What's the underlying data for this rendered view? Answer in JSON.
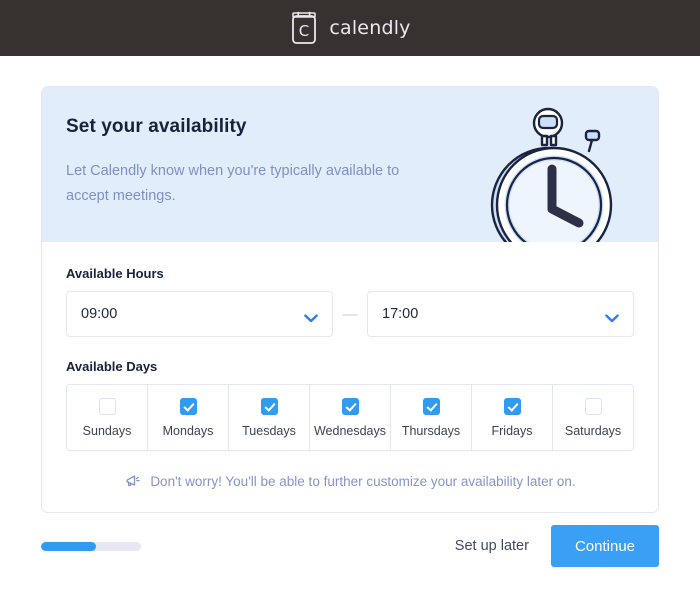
{
  "topbar": {
    "logo_icon": "calendly-calendar-icon",
    "logo_letter": "C",
    "wordmark": "calendly",
    "background": "#37312F"
  },
  "card": {
    "hero": {
      "title": "Set your availability",
      "subtitle": "Let Calendly know when you're typically available to accept meetings.",
      "illustration": "stopwatch-illustration",
      "background": "#E2EDFB"
    },
    "hours": {
      "label": "Available Hours",
      "start_value": "09:00",
      "end_value": "17:00",
      "separator": "—",
      "chevron_icon": "chevron-down-icon",
      "chevron_color": "#2F7DF2"
    },
    "days": {
      "label": "Available Days",
      "items": [
        {
          "name": "Sundays",
          "checked": false
        },
        {
          "name": "Mondays",
          "checked": true
        },
        {
          "name": "Tuesdays",
          "checked": true
        },
        {
          "name": "Wednesdays",
          "checked": true
        },
        {
          "name": "Thursdays",
          "checked": true
        },
        {
          "name": "Fridays",
          "checked": true
        },
        {
          "name": "Saturdays",
          "checked": false
        }
      ]
    },
    "hint": {
      "icon": "megaphone-icon",
      "text": "Don't worry! You'll be able to further customize your availability later on."
    }
  },
  "footer": {
    "progress_percent": 55,
    "progress_fill_color": "#2F9BF2",
    "set_up_later_label": "Set up later",
    "continue_label": "Continue",
    "continue_color": "#3AA0F5"
  }
}
